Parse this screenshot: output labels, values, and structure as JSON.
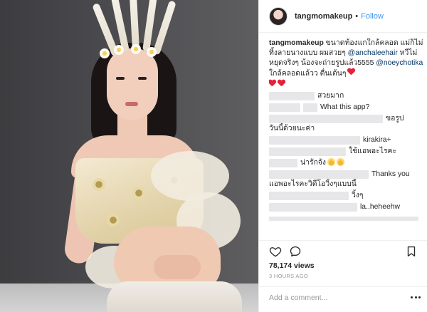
{
  "post": {
    "username": "tangmomakeup",
    "follow_label": "Follow",
    "separator": "•"
  },
  "caption": {
    "username": "tangmomakeup",
    "text_1": " ขนาดท้องแกใกล้คลอด แม่ก็ไม่ทิ้งลายนางแบบ ผมสวยๆ ",
    "mention_1": "@anchaleehair",
    "text_2": " หวีไม่หยุดจริงๆ น้องจะถ่ายรูปแล้ว5555 ",
    "mention_2": "@noeychotika",
    "text_3": " ใกล้คลอดแล้วว ตื่นเต้นๆ"
  },
  "comments": [
    {
      "text": "สวยมาก"
    },
    {
      "text": "What this app?"
    },
    {
      "text": "ขอรูป"
    },
    {
      "text": "วันนี้ด้วยนะค่า"
    },
    {
      "text": "kirakira+"
    },
    {
      "text": "ใช้แอพอะไรคะ"
    },
    {
      "text": "น่ารักจัง"
    },
    {
      "text": "Thanks you"
    },
    {
      "text": "แอพอะไรคะวิดีโอวิ้งๆแบบนี้"
    },
    {
      "text": "วิ้งๆ"
    },
    {
      "text": "la..heheehw"
    }
  ],
  "stats": {
    "views": "78,174 views",
    "time": "3 HOURS AGO"
  },
  "add_comment": {
    "placeholder": "Add a comment..."
  },
  "colors": {
    "link": "#3897f0",
    "mention": "#003569",
    "heart": "#e4223c"
  },
  "icons": [
    "heart-icon",
    "comment-icon",
    "bookmark-icon",
    "more-options-icon",
    "red-heart-emoji",
    "grin-emoji"
  ]
}
